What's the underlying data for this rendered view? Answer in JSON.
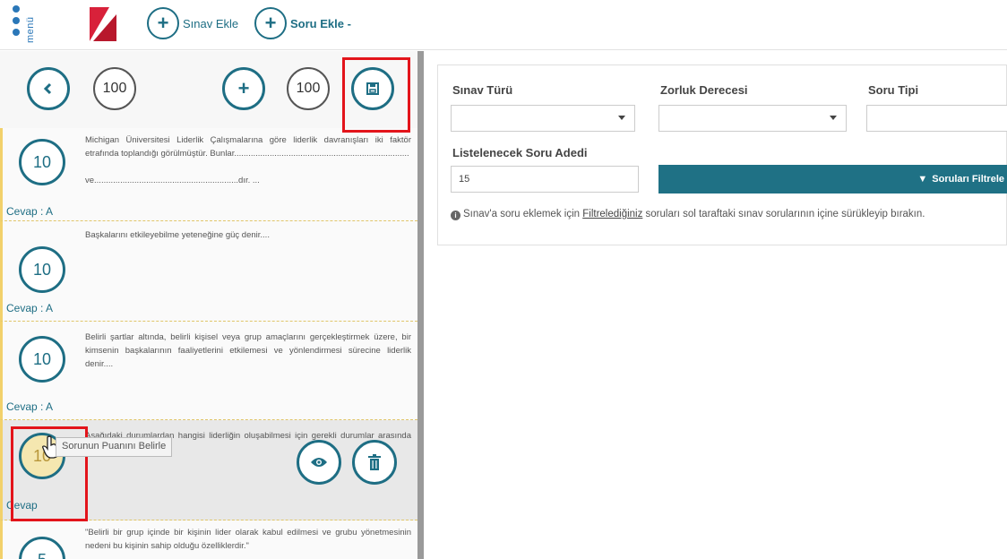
{
  "topbar": {
    "menu_label": "menü",
    "add_exam_label": "Sınav Ekle",
    "add_question_label": "Soru Ekle -"
  },
  "left": {
    "back_icon": "chevron-left-icon",
    "score_left": "100",
    "plus_icon": "plus-icon",
    "score_right": "100",
    "save_icon": "save-icon"
  },
  "questions": [
    {
      "points": "10",
      "text": "Michigan Üniversitesi Liderlik Çalışmalarına göre liderlik davranışları iki faktör etrafında toplandığı görülmüştür. Bunlar..........................................................................",
      "text2": "ve.............................................................dır. ...",
      "answer": "Cevap : A"
    },
    {
      "points": "10",
      "text": "Başkalarını etkileyebilme yeteneğine güç denir....",
      "answer": "Cevap : A"
    },
    {
      "points": "10",
      "text": "Belirli şartlar altında, belirli kişisel veya grup amaçlarını gerçekleştirmek üzere, bir kimsenin başkalarının faaliyetlerini etkilemesi ve yönlendirmesi sürecine liderlik denir....",
      "answer": "Cevap : A"
    },
    {
      "points": "10",
      "text": "Aşağıdaki durumlardan hangisi liderliğin oluşabilmesi için gerekli durumlar arasında sayılamaz?...",
      "answer": "Cevap"
    },
    {
      "points": "5",
      "text": "\"Belirli bir grup içinde bir kişinin lider olarak kabul edilmesi ve grubu yönetmesinin nedeni bu kişinin sahip olduğu özelliklerdir.\""
    }
  ],
  "tooltip": "Sorunun Puanını Belirle",
  "filters": {
    "exam_type_label": "Sınav Türü",
    "difficulty_label": "Zorluk Derecesi",
    "question_type_label": "Soru Tipi",
    "count_label": "Listelenecek Soru Adedi",
    "count_value": "15",
    "filter_button": "Soruları Filtrele",
    "info_prefix": "Sınav'a soru eklemek için ",
    "info_link": "Filtrelediğiniz",
    "info_suffix": " soruları sol taraftaki sınav sorularının içine sürükleyip bırakın."
  },
  "colors": {
    "accent": "#1e6e84",
    "highlight": "#e3141b",
    "answer_bar": "#f2d16b"
  }
}
